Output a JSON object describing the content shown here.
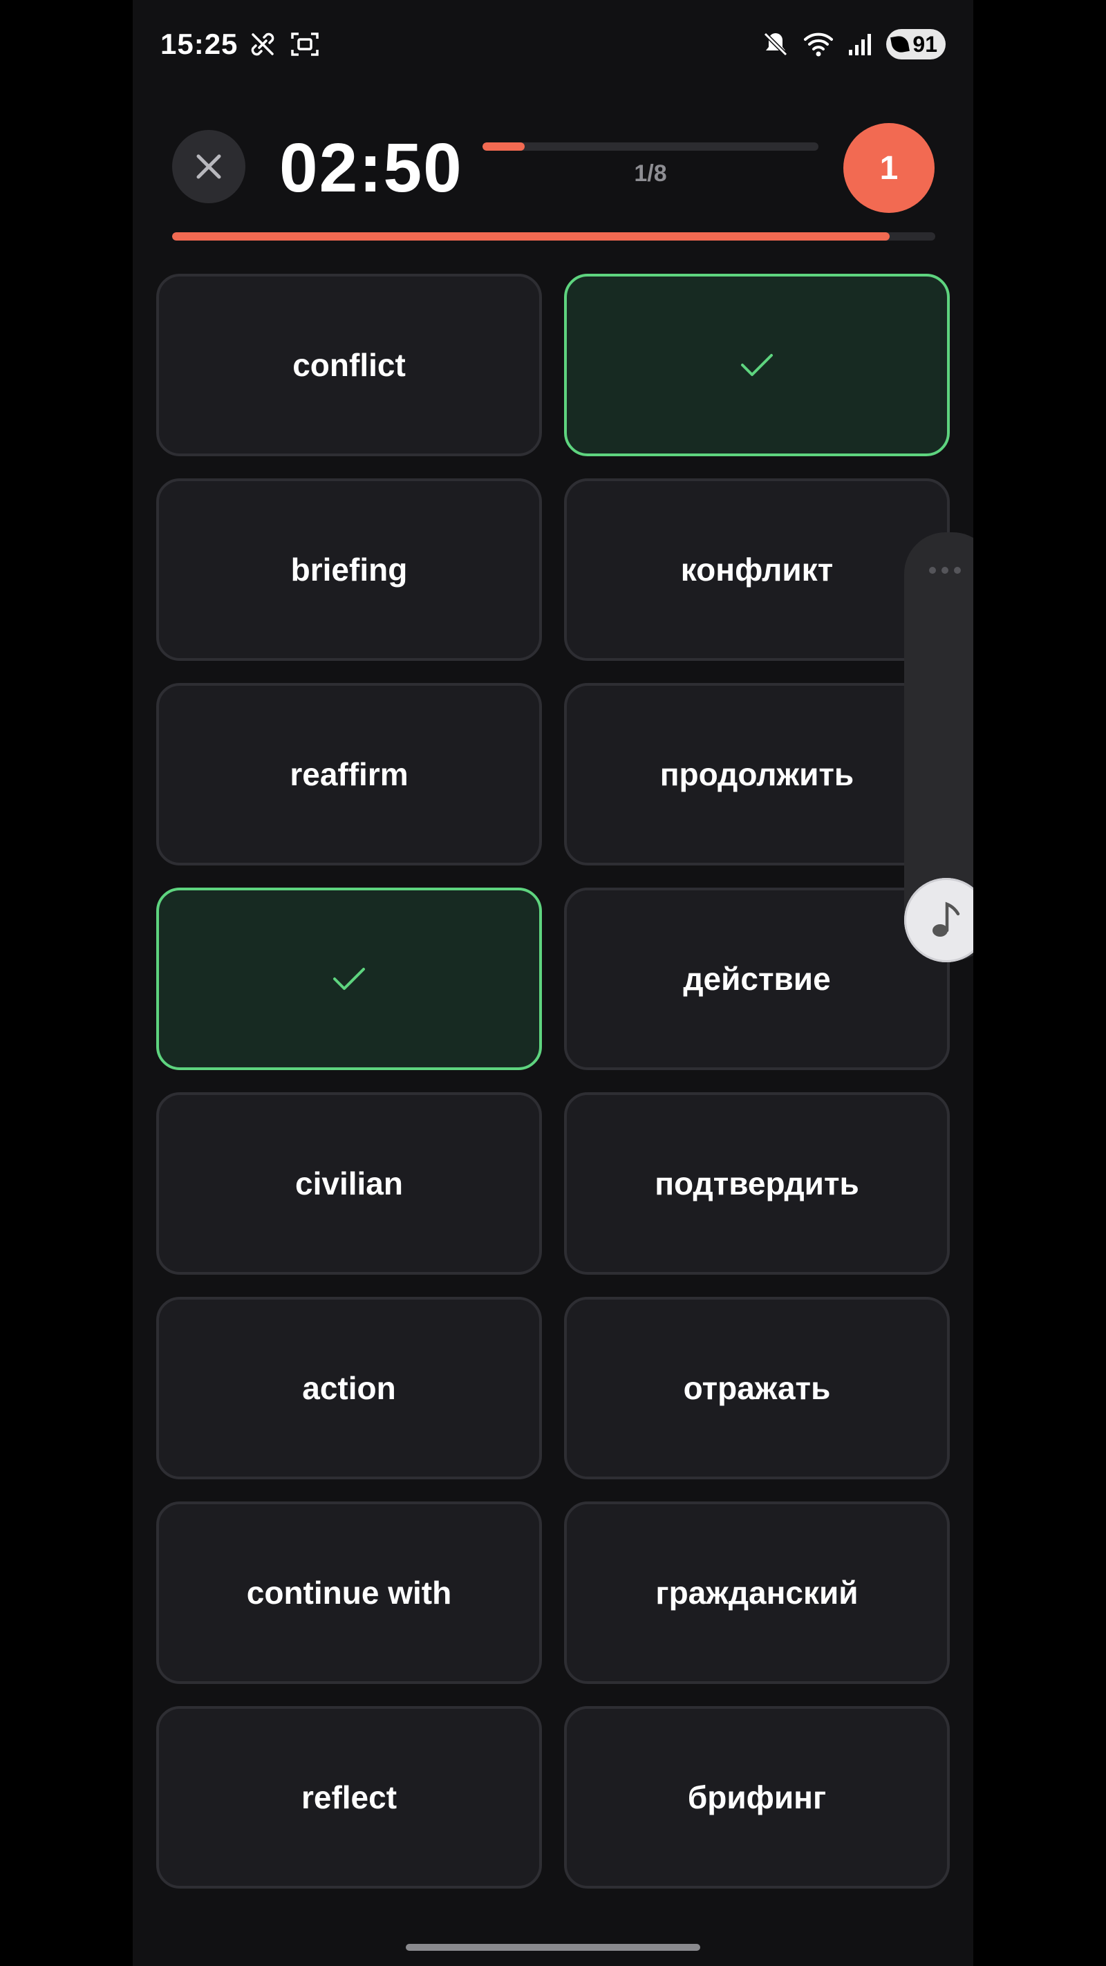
{
  "status_bar": {
    "time": "15:25",
    "battery": "91",
    "icons": [
      "link-off-icon",
      "screen-record-icon",
      "mute-icon",
      "wifi-icon",
      "signal-icon",
      "battery-icon"
    ]
  },
  "header": {
    "timer": "02:50",
    "counter": "1/8",
    "score": "1",
    "round_progress": 0.125,
    "time_progress": 0.94
  },
  "colors": {
    "accent": "#f26a52",
    "matched_border": "#5ed47f",
    "matched_bg": "#172a22",
    "card_bg": "#1c1c20"
  },
  "cards": {
    "r1": {
      "left": "conflict",
      "right": ""
    },
    "r2": {
      "left": "briefing",
      "right": "конфликт"
    },
    "r3": {
      "left": "reaffirm",
      "right": "продолжить"
    },
    "r4": {
      "left": "",
      "right": "действие"
    },
    "r5": {
      "left": "civilian",
      "right": "подтвердить"
    },
    "r6": {
      "left": "action",
      "right": "отражать"
    },
    "r7": {
      "left": "continue with",
      "right": "гражданский"
    },
    "r8": {
      "left": "reflect",
      "right": "брифинг"
    }
  }
}
